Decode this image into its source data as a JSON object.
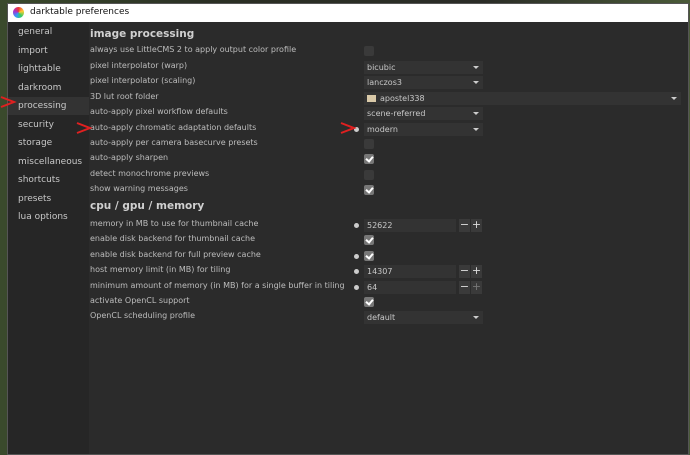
{
  "window": {
    "title": "darktable preferences"
  },
  "sidebar": {
    "items": [
      {
        "label": "general"
      },
      {
        "label": "import"
      },
      {
        "label": "lighttable"
      },
      {
        "label": "darkroom"
      },
      {
        "label": "processing"
      },
      {
        "label": "security"
      },
      {
        "label": "storage"
      },
      {
        "label": "miscellaneous"
      },
      {
        "label": "shortcuts"
      },
      {
        "label": "presets"
      },
      {
        "label": "lua options"
      }
    ],
    "active": "processing"
  },
  "image_processing": {
    "heading": "image processing",
    "rows": [
      {
        "label": "always use LittleCMS 2 to apply output color profile",
        "type": "checkbox",
        "checked": false
      },
      {
        "label": "pixel interpolator (warp)",
        "type": "dropdown",
        "value": "bicubic"
      },
      {
        "label": "pixel interpolator (scaling)",
        "type": "dropdown",
        "value": "lanczos3"
      },
      {
        "label": "3D lut root folder",
        "type": "folder",
        "value": "apostel338",
        "icon": "folder-icon"
      },
      {
        "label": "auto-apply pixel workflow defaults",
        "type": "dropdown",
        "value": "scene-referred"
      },
      {
        "label": "auto-apply chromatic adaptation defaults",
        "type": "dropdown",
        "value": "modern",
        "modified": true
      },
      {
        "label": "auto-apply per camera basecurve presets",
        "type": "checkbox",
        "checked": false
      },
      {
        "label": "auto-apply sharpen",
        "type": "checkbox",
        "checked": true
      },
      {
        "label": "detect monochrome previews",
        "type": "checkbox",
        "checked": false
      },
      {
        "label": "show warning messages",
        "type": "checkbox",
        "checked": true
      }
    ]
  },
  "cpu_gpu_memory": {
    "heading": "cpu / gpu / memory",
    "rows": [
      {
        "label": "memory in MB to use for thumbnail cache",
        "type": "number",
        "value": "52622",
        "modified": true
      },
      {
        "label": "enable disk backend for thumbnail cache",
        "type": "checkbox",
        "checked": true
      },
      {
        "label": "enable disk backend for full preview cache",
        "type": "checkbox",
        "checked": true,
        "modified": true
      },
      {
        "label": "host memory limit (in MB) for tiling",
        "type": "number",
        "value": "14307",
        "modified": true
      },
      {
        "label": "minimum amount of memory (in MB) for a single buffer in tiling",
        "type": "number",
        "value": "64",
        "modified": true
      },
      {
        "label": "activate OpenCL support",
        "type": "checkbox",
        "checked": true
      },
      {
        "label": "OpenCL scheduling profile",
        "type": "dropdown",
        "value": "default"
      }
    ]
  },
  "stepper": {
    "minus": "−",
    "plus": "+"
  },
  "colors": {
    "annotation_arrow": "#e02020",
    "background": "#2b2b2b"
  }
}
